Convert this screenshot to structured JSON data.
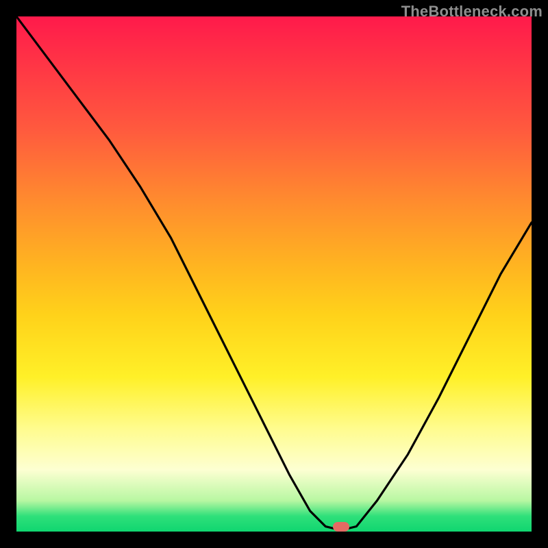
{
  "watermark": "TheBottleneck.com",
  "marker": {
    "x_pct": 63,
    "y_pct": 99.1
  },
  "colors": {
    "frame": "#000000",
    "marker": "#e46a63",
    "curve": "#000000",
    "gradient_top": "#ff1a4b",
    "gradient_bottom": "#10d670"
  },
  "chart_data": {
    "type": "line",
    "title": "",
    "xlabel": "",
    "ylabel": "",
    "xlim": [
      0,
      100
    ],
    "ylim": [
      0,
      100
    ],
    "annotations": [
      {
        "kind": "watermark",
        "text": "TheBottleneck.com",
        "position": "top-right"
      },
      {
        "kind": "marker",
        "shape": "pill",
        "x": 63,
        "y": 0.9,
        "color": "#e46a63"
      }
    ],
    "series": [
      {
        "name": "bottleneck-curve",
        "x": [
          0,
          6,
          12,
          18,
          24,
          30,
          36,
          42,
          48,
          53,
          57,
          60,
          62,
          64,
          66,
          70,
          76,
          82,
          88,
          94,
          100
        ],
        "y": [
          100,
          92,
          84,
          76,
          67,
          57,
          45,
          33,
          21,
          11,
          4,
          1,
          0.5,
          0.5,
          1,
          6,
          15,
          26,
          38,
          50,
          60
        ]
      }
    ],
    "background": {
      "type": "vertical-gradient",
      "meaning": "red=high bottleneck, green=low bottleneck",
      "stops": [
        {
          "pct": 0,
          "color": "#ff1a4b"
        },
        {
          "pct": 50,
          "color": "#ffd21a"
        },
        {
          "pct": 100,
          "color": "#10d670"
        }
      ]
    }
  }
}
